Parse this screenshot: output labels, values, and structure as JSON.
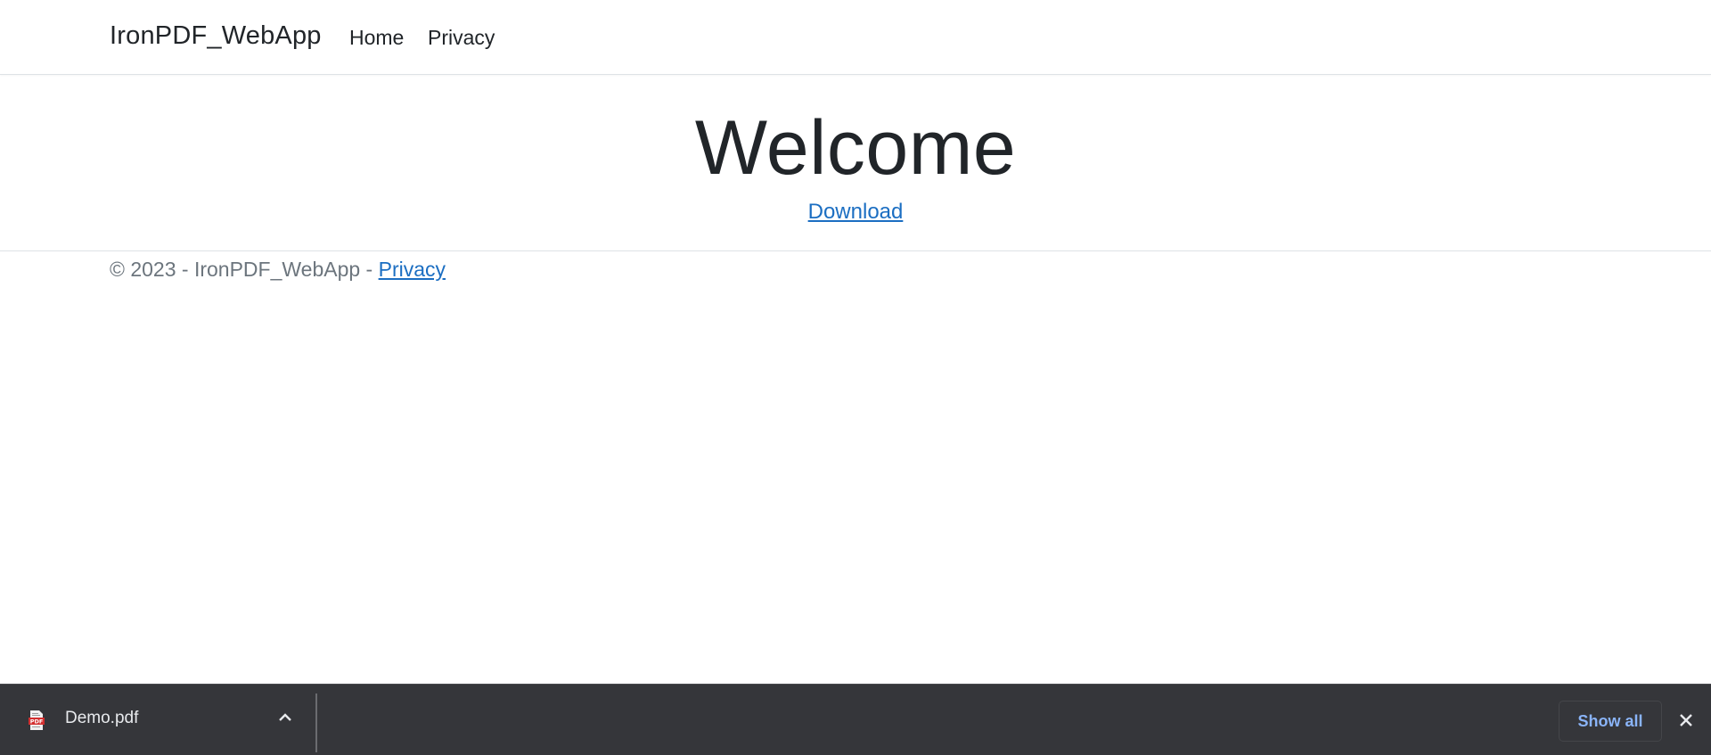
{
  "navbar": {
    "brand": "IronPDF_WebApp",
    "links": [
      {
        "label": "Home"
      },
      {
        "label": "Privacy"
      }
    ]
  },
  "main": {
    "heading": "Welcome",
    "download_link": "Download"
  },
  "footer": {
    "copyright": "© 2023 - IronPDF_WebApp - ",
    "privacy_link": "Privacy"
  },
  "download_bar": {
    "file_name": "Demo.pdf",
    "file_icon": "pdf-file-icon",
    "caret_icon": "chevron-up-icon",
    "show_all_label": "Show all",
    "close_icon": "close-icon",
    "colors": {
      "background": "#35363a",
      "show_all_text": "#8ab4f8",
      "pdf_red": "#d32f2f"
    }
  },
  "colors": {
    "link": "#1b6ec2",
    "text": "#212529",
    "muted": "#6c757d"
  }
}
